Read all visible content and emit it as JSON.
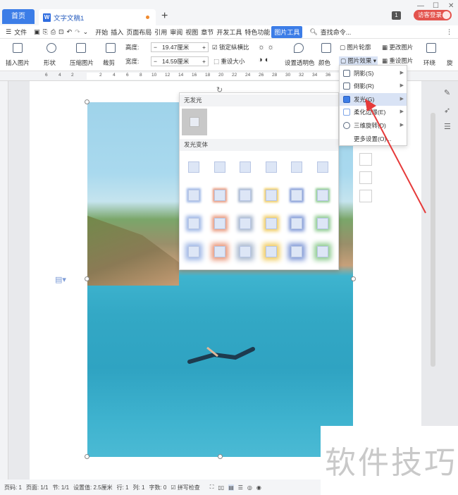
{
  "titlebar": {
    "home_tab": "首页",
    "doc_tab": "文字文稿1",
    "doc_icon": "W",
    "new_tab": "+",
    "badge": "1",
    "login": "访客登录",
    "controls": [
      "—",
      "☐",
      "✕"
    ]
  },
  "menubar": {
    "items": [
      "文件",
      "开始",
      "插入",
      "页面布局",
      "引用",
      "审阅",
      "视图",
      "章节",
      "开发工具",
      "特色功能"
    ],
    "active": "图片工具",
    "search": "查找命令..."
  },
  "ribbon": {
    "insert_pic": "插入图片",
    "shape": "形状",
    "compress": "压缩图片",
    "crop": "裁剪",
    "height_label": "高度:",
    "height_value": "19.47厘米",
    "width_label": "宽度:",
    "width_value": "14.59厘米",
    "lock_ratio": "锁定纵横比",
    "reset_size": "重设大小",
    "set_transparent": "设置透明色",
    "color": "颜色",
    "outline": "图片轮廓",
    "change_pic": "更改图片",
    "effects": "图片效果",
    "reset_pic": "重设图片",
    "wrap": "环绕",
    "rotate": "旋"
  },
  "ruler": {
    "ticks": [
      "6",
      "4",
      "2",
      "",
      "2",
      "4",
      "6",
      "8",
      "10",
      "12",
      "14",
      "16",
      "18",
      "20",
      "22",
      "24",
      "26",
      "28",
      "30",
      "32",
      "34",
      "36",
      "38"
    ]
  },
  "glow_panel": {
    "section_none": "无发光",
    "section_variants": "发光变体",
    "grid_colors": [
      "#9fb7e6",
      "#e8977a",
      "#a9b8cf",
      "#f0cc62",
      "#7f98d6",
      "#8cca8f"
    ]
  },
  "effects_menu": {
    "items": [
      {
        "label": "阴影(S)",
        "icon": "shadow-icon"
      },
      {
        "label": "倒影(R)",
        "icon": "reflection-icon"
      },
      {
        "label": "发光(G)",
        "icon": "glow-icon",
        "highlighted": true
      },
      {
        "label": "柔化边缘(E)",
        "icon": "soft-edge-icon"
      },
      {
        "label": "三维旋转(D)",
        "icon": "3d-rotate-icon"
      },
      {
        "label": "更多设置(O)...",
        "icon": ""
      }
    ]
  },
  "statusbar": {
    "page_code": "页码: 1",
    "page": "页面: 1/1",
    "section": "节: 1/1",
    "settings": "设置值: 2.5厘米",
    "row": "行: 1",
    "col": "列: 1",
    "chars": "字数: 0",
    "spell": "拼写检查"
  },
  "watermark": "软件技巧",
  "colors": {
    "accent": "#3c7de7",
    "login": "#e3534d",
    "arrow": "#e63a3a"
  }
}
